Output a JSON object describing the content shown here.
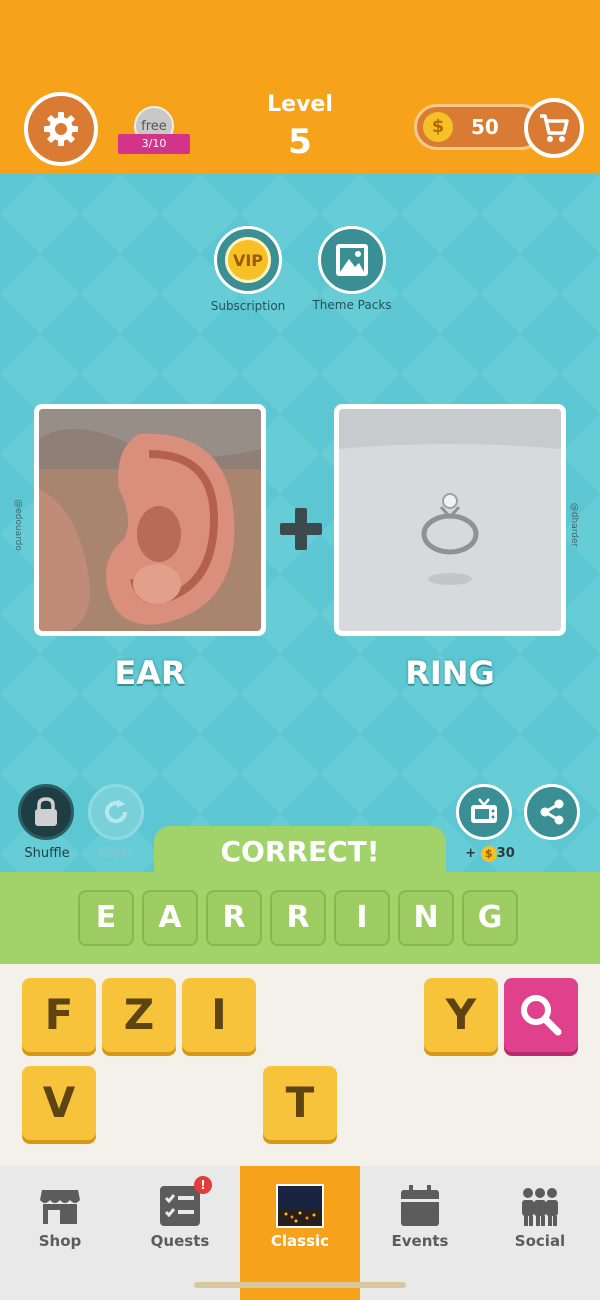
{
  "header": {
    "level_label": "Level",
    "level_number": "5",
    "free_label": "free",
    "free_count": "3/10",
    "coin_symbol": "$",
    "coins": "50"
  },
  "features": {
    "subscription_label": "Subscription",
    "vip_label": "VIP",
    "theme_packs_label": "Theme Packs"
  },
  "puzzle": {
    "left_word": "EAR",
    "right_word": "RING",
    "left_credit": "@edouardo",
    "right_credit": "@dharder"
  },
  "controls": {
    "shuffle_label": "Shuffle",
    "clear_label": "Clear",
    "ad_reward_plus": "+",
    "ad_reward_coin": "$",
    "ad_reward": "30"
  },
  "result": {
    "status": "CORRECT!",
    "answer_letters": [
      "E",
      "A",
      "R",
      "R",
      "I",
      "N",
      "G"
    ]
  },
  "letter_pool": {
    "row1": [
      "F",
      "Z",
      "I",
      "Y"
    ],
    "row2": [
      "V",
      "T"
    ]
  },
  "nav": {
    "items": [
      {
        "label": "Shop",
        "icon": "shop-icon"
      },
      {
        "label": "Quests",
        "icon": "quests-icon",
        "badge": "!"
      },
      {
        "label": "Classic",
        "icon": "classic-icon",
        "active": true
      },
      {
        "label": "Events",
        "icon": "calendar-icon"
      },
      {
        "label": "Social",
        "icon": "people-icon"
      }
    ]
  },
  "colors": {
    "header": "#f6a31b",
    "background": "#5cc7d2",
    "correct_green": "#a2d36b",
    "tile_yellow": "#f6c33b",
    "hint_pink": "#e0418c"
  }
}
